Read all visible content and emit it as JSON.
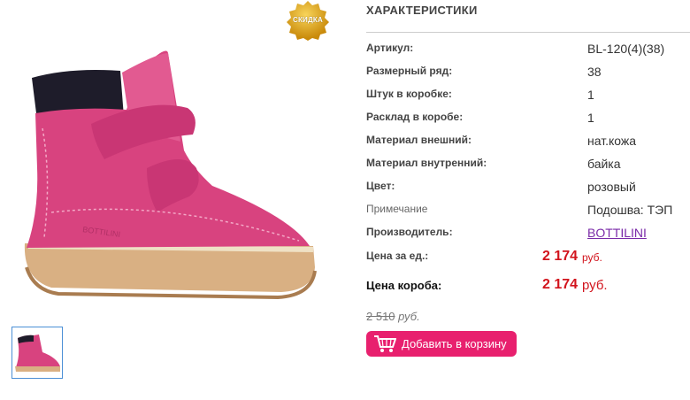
{
  "badge": {
    "label": "СКИДКА"
  },
  "section": {
    "title": "ХАРАКТЕРИСТИКИ"
  },
  "specs": [
    {
      "label": "Артикул:",
      "value": "BL-120(4)(38)"
    },
    {
      "label": "Размерный ряд:",
      "value": "38"
    },
    {
      "label": "Штук в коробке:",
      "value": "1"
    },
    {
      "label": "Расклад в коробе:",
      "value": "1"
    },
    {
      "label": "Материал внешний:",
      "value": "нат.кожа"
    },
    {
      "label": "Материал внутренний:",
      "value": "байка"
    },
    {
      "label": "Цвет:",
      "value": "розовый"
    },
    {
      "label": "Примечание",
      "value": "Подошва: ТЭП"
    },
    {
      "label": "Производитель:",
      "value": "BOTTILINI"
    }
  ],
  "price_unit": {
    "label": "Цена за ед.:",
    "value": "2 174",
    "currency": "руб."
  },
  "price_box": {
    "label": "Цена короба:",
    "value": "2 174",
    "currency": "руб."
  },
  "old_price": {
    "value": "2 510",
    "currency": "руб."
  },
  "cart": {
    "label": "Добавить в корзину"
  },
  "colors": {
    "accent": "#e8206e",
    "price": "#d2141d",
    "boot": "#d8437f"
  }
}
